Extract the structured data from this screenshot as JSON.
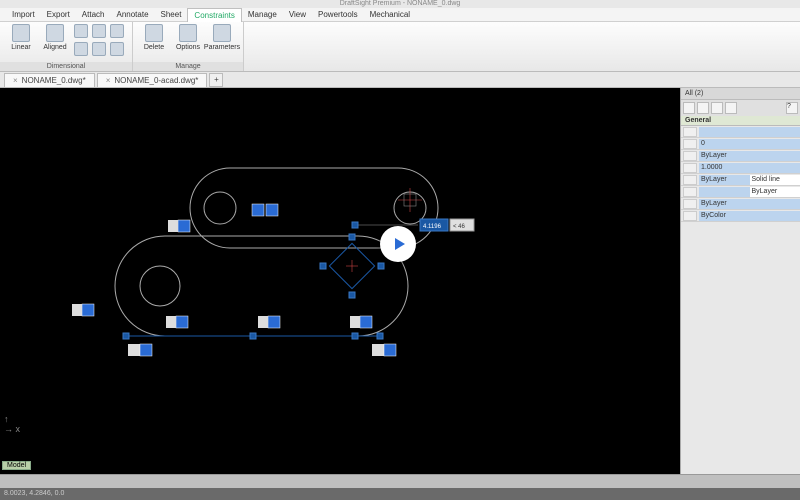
{
  "title": "DraftSight Premium - NONAME_0.dwg",
  "menu": [
    "Import",
    "Export",
    "Attach",
    "Annotate",
    "Sheet",
    "Constraints",
    "Manage",
    "View",
    "Powertools",
    "Mechanical"
  ],
  "menu_active": 5,
  "ribbon": {
    "panels": [
      {
        "title": "Dimensional",
        "big": [
          {
            "name": "linear-dim",
            "label": "Linear"
          },
          {
            "name": "aligned-dim",
            "label": "Aligned"
          }
        ]
      },
      {
        "title": "Manage",
        "big": [
          {
            "name": "delete-constraint",
            "label": "Delete"
          },
          {
            "name": "options-constraint",
            "label": "Options"
          },
          {
            "name": "parameters",
            "label": "Parameters"
          }
        ]
      }
    ]
  },
  "tabs": [
    {
      "label": "NONAME_0.dwg*"
    },
    {
      "label": "NONAME_0-acad.dwg*"
    }
  ],
  "addtab": "+",
  "dim_value": "4.1196",
  "angle_value": "< 46",
  "props": {
    "hdr": "All (2)",
    "section": "General",
    "rows": [
      {
        "name": "color",
        "val": ""
      },
      {
        "name": "layer",
        "val": "0"
      },
      {
        "name": "linetype",
        "val": "ByLayer"
      },
      {
        "name": "linescale",
        "val": "1.0000"
      },
      {
        "name": "plotstyle",
        "val": "ByLayer",
        "val2": "Solid line"
      },
      {
        "name": "lineweight",
        "val": "",
        "val2": "ByLayer"
      },
      {
        "name": "transparency",
        "val": "ByLayer"
      },
      {
        "name": "printcolor",
        "val": "ByColor"
      }
    ]
  },
  "pill": "Model",
  "cmd": "",
  "status": "8.0023, 4.2846, 0.0"
}
